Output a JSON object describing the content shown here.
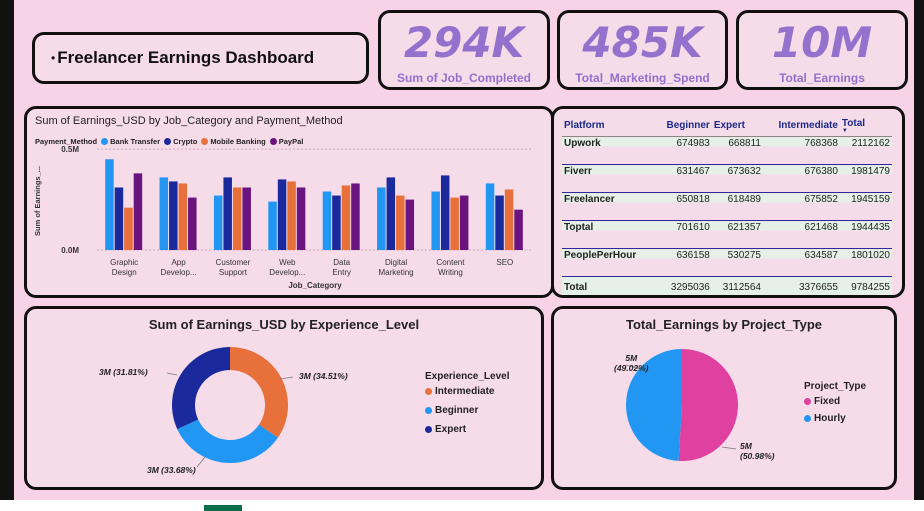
{
  "title": "Freelancer Earnings Dashboard",
  "kpis": [
    {
      "value": "294K",
      "label": "Sum of Job_Completed"
    },
    {
      "value": "485K",
      "label": "Total_Marketing_Spend"
    },
    {
      "value": "10M",
      "label": "Total_Earnings"
    }
  ],
  "colors": {
    "bank": "#2196f3",
    "crypto": "#1a2a9c",
    "mobile": "#e8703a",
    "paypal": "#6b1480",
    "kpi": "#9471cc",
    "fixed": "#e040a0",
    "hourly": "#2196f3",
    "intermediate": "#e8703a",
    "beginner": "#2196f3",
    "expert": "#1a2a9c"
  },
  "bar_chart": {
    "title": "Sum of Earnings_USD by Job_Category and Payment_Method",
    "legend_title": "Payment_Method",
    "ylabel": "Sum of Earnings_...",
    "xlabel": "Job_Category",
    "ytick_top": "0.5M",
    "ytick_bottom": "0.0M"
  },
  "table": {
    "headers": [
      "Platform",
      "Beginner",
      "Expert",
      "Intermediate",
      "Total"
    ],
    "rows": [
      [
        "Upwork",
        "674983",
        "668811",
        "768368",
        "2112162"
      ],
      [
        "Fiverr",
        "631467",
        "673632",
        "676380",
        "1981479"
      ],
      [
        "Freelancer",
        "650818",
        "618489",
        "675852",
        "1945159"
      ],
      [
        "Toptal",
        "701610",
        "621357",
        "621468",
        "1944435"
      ],
      [
        "PeoplePerHour",
        "636158",
        "530275",
        "634587",
        "1801020"
      ]
    ],
    "total": [
      "Total",
      "3295036",
      "3112564",
      "3376655",
      "9784255"
    ]
  },
  "donut": {
    "title": "Sum of Earnings_USD by Experience_Level",
    "legend_title": "Experience_Level",
    "legend": [
      "Intermediate",
      "Beginner",
      "Expert"
    ],
    "labels": {
      "intermediate": "3M (34.51%)",
      "beginner": "3M (33.68%)",
      "expert": "3M (31.81%)"
    }
  },
  "pie": {
    "title": "Total_Earnings by Project_Type",
    "legend_title": "Project_Type",
    "legend": [
      "Fixed",
      "Hourly"
    ],
    "labels": {
      "fixed_top": "5M",
      "fixed_bot": "(50.98%)",
      "hourly_top": "5M",
      "hourly_bot": "(49.02%)"
    }
  },
  "chart_data": [
    {
      "type": "bar",
      "title": "Sum of Earnings_USD by Job_Category and Payment_Method",
      "xlabel": "Job_Category",
      "ylabel": "Sum of Earnings_...",
      "ylim": [
        0,
        0.6
      ],
      "categories": [
        "Graphic Design",
        "App Develop...",
        "Customer Support",
        "Web Develop...",
        "Data Entry",
        "Digital Marketing",
        "Content Writing",
        "SEO"
      ],
      "series": [
        {
          "name": "Bank Transfer",
          "values": [
            0.45,
            0.36,
            0.27,
            0.24,
            0.29,
            0.31,
            0.29,
            0.33
          ]
        },
        {
          "name": "Crypto",
          "values": [
            0.31,
            0.34,
            0.36,
            0.35,
            0.27,
            0.36,
            0.37,
            0.27
          ]
        },
        {
          "name": "Mobile Banking",
          "values": [
            0.21,
            0.33,
            0.31,
            0.34,
            0.32,
            0.27,
            0.26,
            0.3
          ]
        },
        {
          "name": "PayPal",
          "values": [
            0.38,
            0.26,
            0.31,
            0.31,
            0.33,
            0.25,
            0.27,
            0.2
          ]
        }
      ],
      "legend": "top-left"
    },
    {
      "type": "pie",
      "title": "Sum of Earnings_USD by Experience_Level",
      "categories": [
        "Intermediate",
        "Beginner",
        "Expert"
      ],
      "values": [
        34.51,
        33.68,
        31.81
      ]
    },
    {
      "type": "pie",
      "title": "Total_Earnings by Project_Type",
      "categories": [
        "Fixed",
        "Hourly"
      ],
      "values": [
        50.98,
        49.02
      ]
    }
  ]
}
